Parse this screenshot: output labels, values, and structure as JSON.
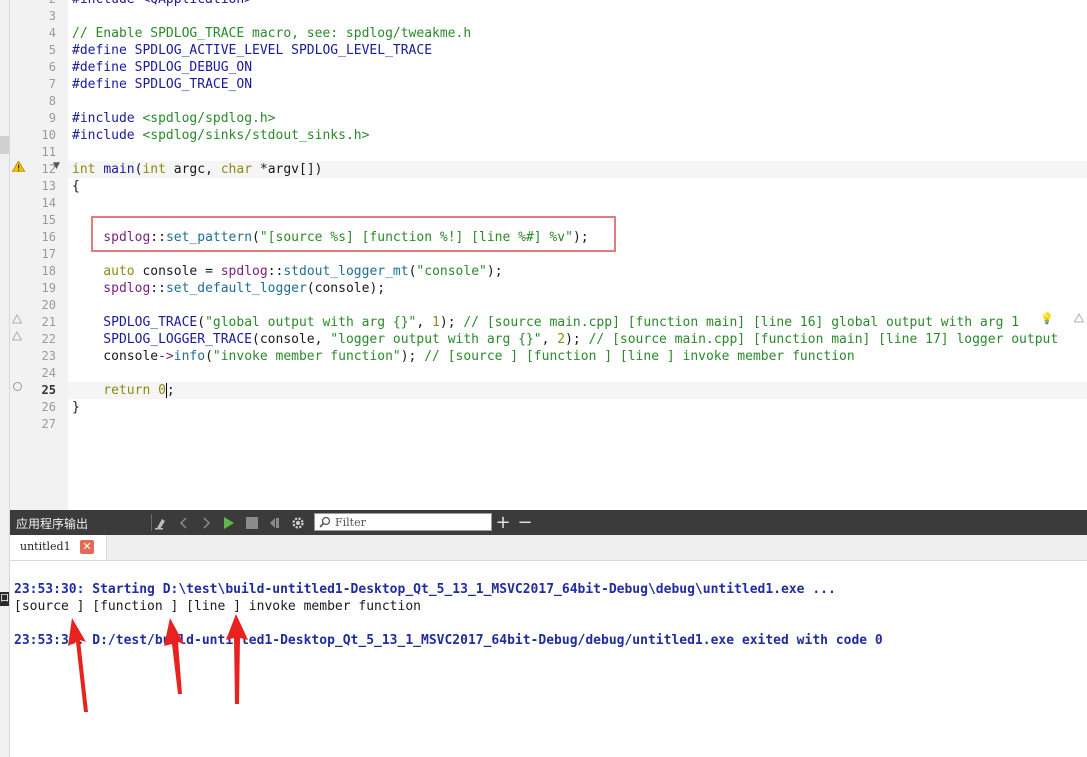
{
  "editor": {
    "lines": [
      {
        "n": "2",
        "segs": [
          {
            "t": "#include <QApplication>",
            "c": "c-pp"
          }
        ]
      },
      {
        "n": "3",
        "segs": []
      },
      {
        "n": "4",
        "segs": [
          {
            "t": "// Enable SPDLOG_TRACE macro, see: spdlog/tweakme.h",
            "c": "c-com"
          }
        ]
      },
      {
        "n": "5",
        "segs": [
          {
            "t": "#define ",
            "c": "c-pp"
          },
          {
            "t": "SPDLOG_ACTIVE_LEVEL SPDLOG_LEVEL_TRACE",
            "c": "c-pp"
          }
        ]
      },
      {
        "n": "6",
        "segs": [
          {
            "t": "#define ",
            "c": "c-pp"
          },
          {
            "t": "SPDLOG_DEBUG_ON",
            "c": "c-pp"
          }
        ]
      },
      {
        "n": "7",
        "segs": [
          {
            "t": "#define ",
            "c": "c-pp"
          },
          {
            "t": "SPDLOG_TRACE_ON",
            "c": "c-pp"
          }
        ]
      },
      {
        "n": "8",
        "segs": []
      },
      {
        "n": "9",
        "segs": [
          {
            "t": "#include ",
            "c": "c-pp"
          },
          {
            "t": "<spdlog/spdlog.h>",
            "c": "c-str"
          }
        ]
      },
      {
        "n": "10",
        "segs": [
          {
            "t": "#include ",
            "c": "c-pp"
          },
          {
            "t": "<spdlog/sinks/stdout_sinks.h>",
            "c": "c-str"
          }
        ]
      },
      {
        "n": "11",
        "segs": []
      },
      {
        "n": "12",
        "segs": [
          {
            "t": "int ",
            "c": "c-kw"
          },
          {
            "t": "main",
            "c": "c-pp"
          },
          {
            "t": "(",
            "c": "c-plain"
          },
          {
            "t": "int ",
            "c": "c-kw"
          },
          {
            "t": "argc",
            "c": "c-plain"
          },
          {
            "t": ", ",
            "c": "c-plain"
          },
          {
            "t": "char ",
            "c": "c-kw"
          },
          {
            "t": "*argv[])",
            "c": "c-plain"
          }
        ]
      },
      {
        "n": "13",
        "segs": [
          {
            "t": "{",
            "c": "c-plain"
          }
        ]
      },
      {
        "n": "14",
        "segs": []
      },
      {
        "n": "15",
        "segs": []
      },
      {
        "n": "16",
        "segs": [
          {
            "t": "    spdlog",
            "c": "c-ns"
          },
          {
            "t": "::",
            "c": "c-plain"
          },
          {
            "t": "set_pattern",
            "c": "c-fn"
          },
          {
            "t": "(",
            "c": "c-plain"
          },
          {
            "t": "\"[source %s] [function %!] [line %#] %v\"",
            "c": "c-str"
          },
          {
            "t": ");",
            "c": "c-plain"
          }
        ]
      },
      {
        "n": "17",
        "segs": []
      },
      {
        "n": "18",
        "segs": [
          {
            "t": "    auto ",
            "c": "c-kw"
          },
          {
            "t": "console = ",
            "c": "c-plain"
          },
          {
            "t": "spdlog",
            "c": "c-ns"
          },
          {
            "t": "::",
            "c": "c-plain"
          },
          {
            "t": "stdout_logger_mt",
            "c": "c-fn"
          },
          {
            "t": "(",
            "c": "c-plain"
          },
          {
            "t": "\"console\"",
            "c": "c-str"
          },
          {
            "t": ");",
            "c": "c-plain"
          }
        ]
      },
      {
        "n": "19",
        "segs": [
          {
            "t": "    spdlog",
            "c": "c-ns"
          },
          {
            "t": "::",
            "c": "c-plain"
          },
          {
            "t": "set_default_logger",
            "c": "c-fn"
          },
          {
            "t": "(console);",
            "c": "c-plain"
          }
        ]
      },
      {
        "n": "20",
        "segs": []
      },
      {
        "n": "21",
        "segs": [
          {
            "t": "    SPDLOG_TRACE",
            "c": "c-pp"
          },
          {
            "t": "(",
            "c": "c-plain"
          },
          {
            "t": "\"global output with arg {}\"",
            "c": "c-str"
          },
          {
            "t": ", ",
            "c": "c-plain"
          },
          {
            "t": "1",
            "c": "c-kw"
          },
          {
            "t": "); ",
            "c": "c-plain"
          },
          {
            "t": "// [source main.cpp] [function main] [line 16] global output with arg 1",
            "c": "c-com"
          }
        ]
      },
      {
        "n": "22",
        "segs": [
          {
            "t": "    SPDLOG_LOGGER_TRACE",
            "c": "c-pp"
          },
          {
            "t": "(console, ",
            "c": "c-plain"
          },
          {
            "t": "\"logger output with arg {}\"",
            "c": "c-str"
          },
          {
            "t": ", ",
            "c": "c-plain"
          },
          {
            "t": "2",
            "c": "c-kw"
          },
          {
            "t": "); ",
            "c": "c-plain"
          },
          {
            "t": "// [source main.cpp] [function main] [line 17] logger output",
            "c": "c-com"
          }
        ]
      },
      {
        "n": "23",
        "segs": [
          {
            "t": "    console",
            "c": "c-plain"
          },
          {
            "t": "->",
            "c": "c-ns"
          },
          {
            "t": "info",
            "c": "c-fn"
          },
          {
            "t": "(",
            "c": "c-plain"
          },
          {
            "t": "\"invoke member function\"",
            "c": "c-str"
          },
          {
            "t": "); ",
            "c": "c-plain"
          },
          {
            "t": "// [source ] [function ] [line ] invoke member function",
            "c": "c-com"
          }
        ]
      },
      {
        "n": "24",
        "segs": []
      },
      {
        "n": "25",
        "segs": [
          {
            "t": "    return ",
            "c": "c-kw"
          },
          {
            "t": "0",
            "c": "c-kw"
          }
        ]
      },
      {
        "n": "26",
        "segs": [
          {
            "t": "}",
            "c": "c-plain"
          }
        ]
      },
      {
        "n": "27",
        "segs": []
      }
    ],
    "line25_tail": ";"
  },
  "output_bar": {
    "title": "应用程序输出",
    "filter_placeholder": "Filter",
    "icons": [
      "clear-icon",
      "back-icon",
      "forward-icon",
      "run-icon",
      "stop-icon",
      "settings-icon",
      "plus-icon",
      "minus-icon"
    ]
  },
  "tab": {
    "label": "untitled1",
    "close": "✕"
  },
  "output": {
    "line1": "23:53:30: Starting D:\\test\\build-untitled1-Desktop_Qt_5_13_1_MSVC2017_64bit-Debug\\debug\\untitled1.exe ...",
    "line2": "[source ] [function ] [line ] invoke member function",
    "line3": "23:53:30: D:/test/build-untitled1-Desktop_Qt_5_13_1_MSVC2017_64bit-Debug/debug/untitled1.exe exited with code 0"
  },
  "colors": {
    "highlight_box": "#e57c7c",
    "arrow": "#e8231f",
    "output_blue": "#1f2d9e"
  }
}
